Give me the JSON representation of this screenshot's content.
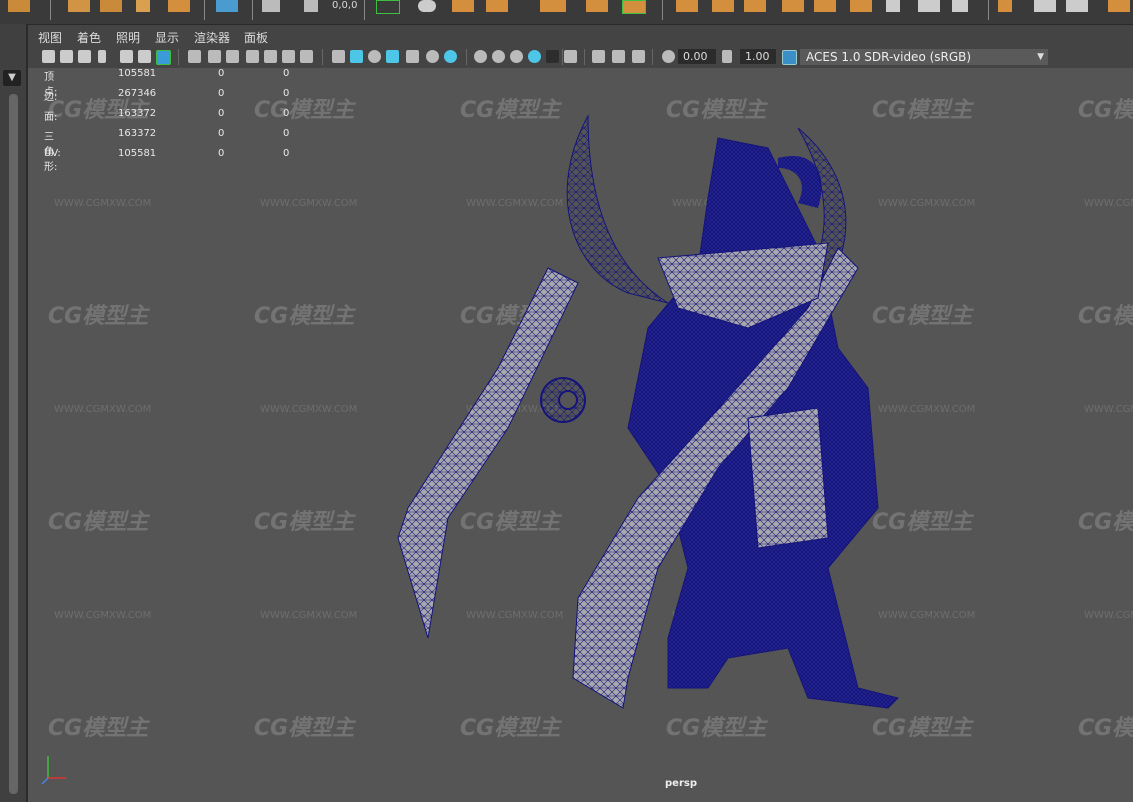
{
  "shelf": {
    "left_readout": "0,0,0"
  },
  "menu": {
    "items": [
      "视图",
      "着色",
      "照明",
      "显示",
      "渲染器",
      "面板"
    ]
  },
  "toolbar": {
    "exposure_value": "0.00",
    "gamma_value": "1.00",
    "color_space": "ACES 1.0 SDR-video (sRGB)",
    "accent_color": "#4ec6e8",
    "highlight_color": "#3fbf3f"
  },
  "hud": {
    "rows": [
      {
        "label": "顶点:",
        "value": "105581",
        "sel": "0",
        "tri": "0"
      },
      {
        "label": "边:",
        "value": "267346",
        "sel": "0",
        "tri": "0"
      },
      {
        "label": "面:",
        "value": "163372",
        "sel": "0",
        "tri": "0"
      },
      {
        "label": "三角形:",
        "value": "163372",
        "sel": "0",
        "tri": "0"
      },
      {
        "label": "UV:",
        "value": "105581",
        "sel": "0",
        "tri": "0"
      }
    ]
  },
  "viewport": {
    "camera": "persp",
    "background": "#555555",
    "wireframe_color": "#14147a",
    "mesh_face_color": "#a9a9ad"
  },
  "watermark": {
    "logo": "CG模型主",
    "url": "WWW.CGMXW.COM"
  }
}
